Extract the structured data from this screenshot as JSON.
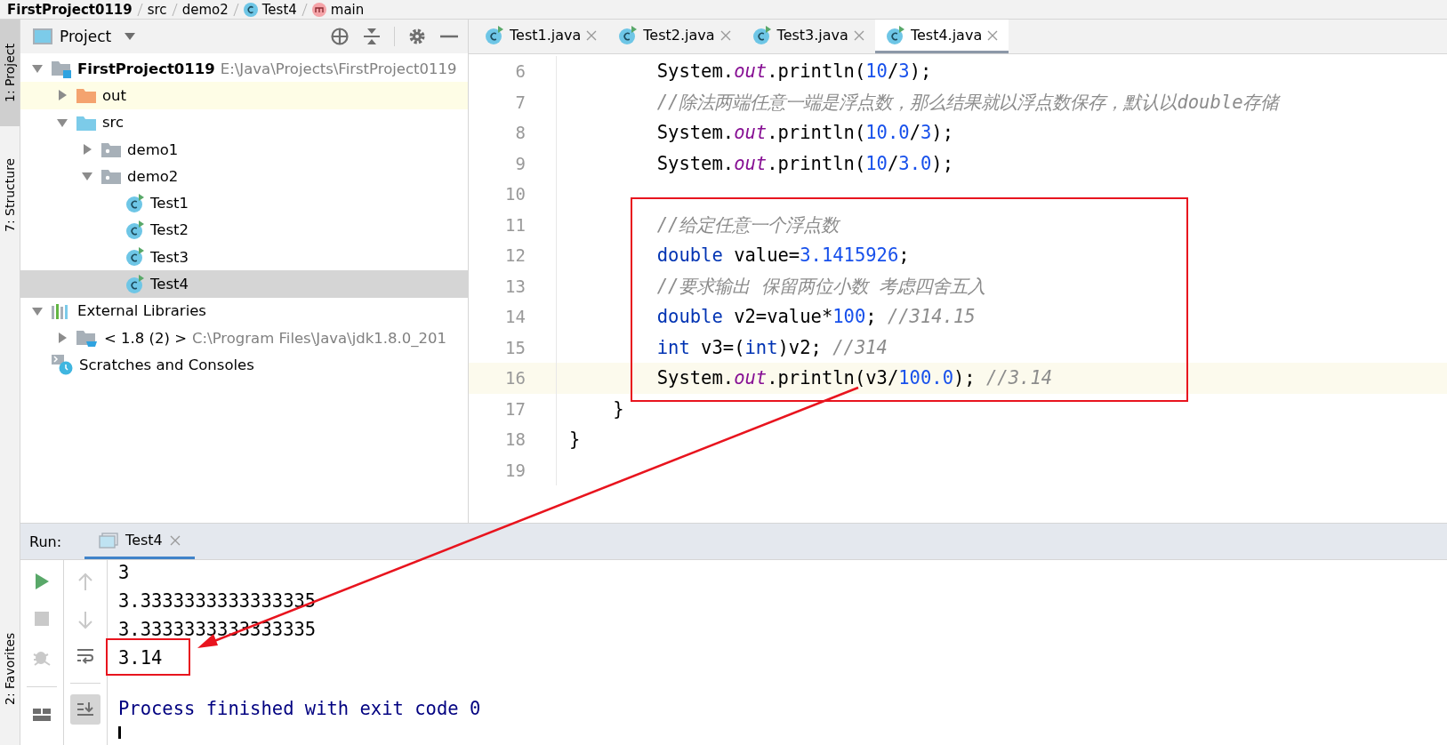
{
  "breadcrumbs": [
    {
      "label": "FirstProject0119",
      "kind": "project"
    },
    {
      "label": "src",
      "kind": "folder"
    },
    {
      "label": "demo2",
      "kind": "folder"
    },
    {
      "label": "Test4",
      "kind": "class"
    },
    {
      "label": "main",
      "kind": "method"
    }
  ],
  "tool_stripe": [
    {
      "label": "1: Project",
      "selected": true
    },
    {
      "label": "7: Structure",
      "selected": false
    },
    {
      "label": "2: Favorites",
      "selected": false
    }
  ],
  "project_panel": {
    "title": "Project",
    "tree": [
      {
        "label": "FirstProject0119",
        "path": "E:\\Java\\Projects\\FirstProject0119",
        "kind": "project",
        "expanded": true,
        "selected": false,
        "children": [
          {
            "label": "out",
            "kind": "excluded-folder",
            "expanded": false,
            "selected": false
          },
          {
            "label": "src",
            "kind": "source-folder",
            "expanded": true,
            "selected": false,
            "children": [
              {
                "label": "demo1",
                "kind": "package",
                "expanded": false,
                "selected": false
              },
              {
                "label": "demo2",
                "kind": "package",
                "expanded": true,
                "selected": false,
                "children": [
                  {
                    "label": "Test1",
                    "kind": "class",
                    "selected": false
                  },
                  {
                    "label": "Test2",
                    "kind": "class",
                    "selected": false
                  },
                  {
                    "label": "Test3",
                    "kind": "class",
                    "selected": false
                  },
                  {
                    "label": "Test4",
                    "kind": "class",
                    "selected": true
                  }
                ]
              }
            ]
          }
        ]
      },
      {
        "label": "External Libraries",
        "kind": "libraries",
        "expanded": true,
        "selected": false,
        "children": [
          {
            "label": "< 1.8 (2) >",
            "path": "C:\\Program Files\\Java\\jdk1.8.0_201",
            "kind": "sdk",
            "expanded": false,
            "selected": false
          }
        ]
      },
      {
        "label": "Scratches and Consoles",
        "kind": "scratches",
        "selected": false
      }
    ]
  },
  "editor_tabs": [
    {
      "label": "Test1.java",
      "selected": false
    },
    {
      "label": "Test2.java",
      "selected": false
    },
    {
      "label": "Test3.java",
      "selected": false
    },
    {
      "label": "Test4.java",
      "selected": true
    }
  ],
  "code_lines": [
    {
      "number": "6",
      "current": false,
      "tokens": [
        {
          "text": "        System.",
          "kind": "plain"
        },
        {
          "text": "out",
          "kind": "field"
        },
        {
          "text": ".println(",
          "kind": "plain"
        },
        {
          "text": "10",
          "kind": "number"
        },
        {
          "text": "/",
          "kind": "plain"
        },
        {
          "text": "3",
          "kind": "number"
        },
        {
          "text": ");",
          "kind": "plain"
        }
      ]
    },
    {
      "number": "7",
      "current": false,
      "tokens": [
        {
          "text": "        //除法两端任意一端是浮点数，那么结果就以浮点数保存，默认以double存储",
          "kind": "comment"
        }
      ]
    },
    {
      "number": "8",
      "current": false,
      "tokens": [
        {
          "text": "        System.",
          "kind": "plain"
        },
        {
          "text": "out",
          "kind": "field"
        },
        {
          "text": ".println(",
          "kind": "plain"
        },
        {
          "text": "10.0",
          "kind": "number"
        },
        {
          "text": "/",
          "kind": "plain"
        },
        {
          "text": "3",
          "kind": "number"
        },
        {
          "text": ");",
          "kind": "plain"
        }
      ]
    },
    {
      "number": "9",
      "current": false,
      "tokens": [
        {
          "text": "        System.",
          "kind": "plain"
        },
        {
          "text": "out",
          "kind": "field"
        },
        {
          "text": ".println(",
          "kind": "plain"
        },
        {
          "text": "10",
          "kind": "number"
        },
        {
          "text": "/",
          "kind": "plain"
        },
        {
          "text": "3.0",
          "kind": "number"
        },
        {
          "text": ");",
          "kind": "plain"
        }
      ]
    },
    {
      "number": "10",
      "current": false
    },
    {
      "number": "11",
      "current": false,
      "tokens": [
        {
          "text": "        //给定任意一个浮点数",
          "kind": "comment"
        }
      ]
    },
    {
      "number": "12",
      "current": false,
      "tokens": [
        {
          "text": "        double",
          "kind": "keyword"
        },
        {
          "text": " value=",
          "kind": "plain"
        },
        {
          "text": "3.1415926",
          "kind": "number"
        },
        {
          "text": ";",
          "kind": "plain"
        }
      ]
    },
    {
      "number": "13",
      "current": false,
      "tokens": [
        {
          "text": "        //要求输出 保留两位小数 考虑四舍五入",
          "kind": "comment"
        }
      ]
    },
    {
      "number": "14",
      "current": false,
      "tokens": [
        {
          "text": "        double",
          "kind": "keyword"
        },
        {
          "text": " v2=value*",
          "kind": "plain"
        },
        {
          "text": "100",
          "kind": "number"
        },
        {
          "text": "; ",
          "kind": "plain"
        },
        {
          "text": "//314.15",
          "kind": "comment"
        }
      ]
    },
    {
      "number": "15",
      "current": false,
      "tokens": [
        {
          "text": "        int",
          "kind": "keyword"
        },
        {
          "text": " v3=(",
          "kind": "plain"
        },
        {
          "text": "int",
          "kind": "keyword"
        },
        {
          "text": ")v2; ",
          "kind": "plain"
        },
        {
          "text": "//314",
          "kind": "comment"
        }
      ]
    },
    {
      "number": "16",
      "current": true,
      "tokens": [
        {
          "text": "        System.",
          "kind": "plain"
        },
        {
          "text": "out",
          "kind": "field"
        },
        {
          "text": ".println(v3/",
          "kind": "plain"
        },
        {
          "text": "100.0",
          "kind": "number"
        },
        {
          "text": "); ",
          "kind": "plain"
        },
        {
          "text": "//3.14",
          "kind": "comment"
        }
      ]
    },
    {
      "number": "17",
      "current": false,
      "tokens": [
        {
          "text": "    }",
          "kind": "plain"
        }
      ]
    },
    {
      "number": "18",
      "current": false,
      "tokens": [
        {
          "text": "}",
          "kind": "plain"
        }
      ]
    },
    {
      "number": "19",
      "current": false
    }
  ],
  "run_panel": {
    "label": "Run:",
    "tabs": [
      {
        "label": "Test4",
        "selected": true
      }
    ],
    "output": [
      {
        "text": "3",
        "kind": "stdout"
      },
      {
        "text": "3.3333333333333335",
        "kind": "stdout"
      },
      {
        "text": "3.3333333333333335",
        "kind": "stdout"
      },
      {
        "text": "3.14",
        "kind": "stdout"
      },
      {
        "text": "Process finished with exit code 0",
        "kind": "system"
      }
    ]
  }
}
